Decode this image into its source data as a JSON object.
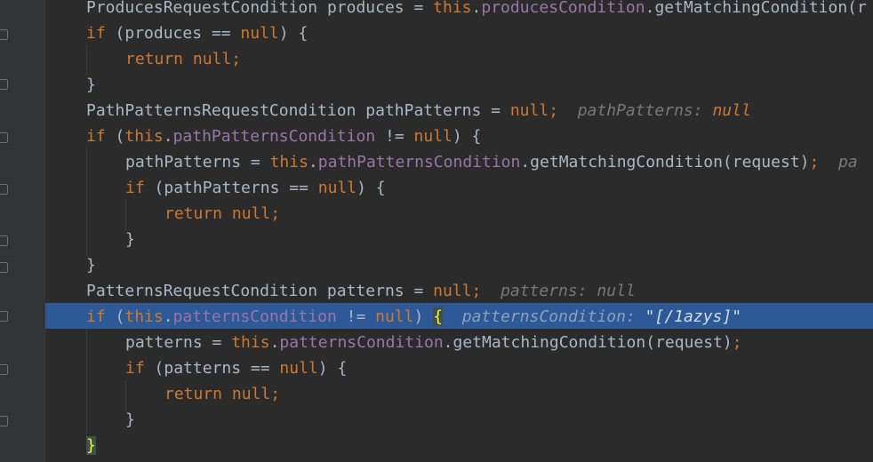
{
  "theme": {
    "background": "#2b2b2b",
    "gutter": "#313335",
    "execution_line": "#2d5a96",
    "keyword": "#cc7832",
    "field": "#9876aa",
    "text": "#a9b7c6"
  },
  "code": {
    "l1": {
      "type": "ProducesRequestCondition",
      "var": "produces",
      "eq": "=",
      "this": "this",
      "dot": ".",
      "field": "producesCondition",
      "call": ".getMatchingCondition(r"
    },
    "l2": {
      "kw": "if",
      "rest": " (produces == ",
      "null": "null",
      "close": ") {"
    },
    "l3": {
      "kw": "return",
      "null": "null",
      "semi": ";"
    },
    "l4": {
      "text": "}"
    },
    "l5": {
      "decl": "PathPatternsRequestCondition pathPatterns = ",
      "null": "null",
      "semi": ";",
      "hint_name": "pathPatterns:",
      "hint_value": "null"
    },
    "l6": {
      "kw": "if",
      "open": " (",
      "this": "this",
      "dot": ".",
      "field": "pathPatternsCondition",
      "op": " != ",
      "null": "null",
      "close": ") {"
    },
    "l7": {
      "lhs": "pathPatterns = ",
      "this": "this",
      "dot": ".",
      "field": "pathPatternsCondition",
      "call": ".getMatchingCondition(request)",
      "semi": ";",
      "hint_name": "pa"
    },
    "l8": {
      "kw": "if",
      "rest": " (pathPatterns == ",
      "null": "null",
      "close": ") {"
    },
    "l9": {
      "kw": "return",
      "null": "null",
      "semi": ";"
    },
    "l10": {
      "text": "}"
    },
    "l11": {
      "text": "}"
    },
    "l12": {
      "decl": "PatternsRequestCondition patterns = ",
      "null": "null",
      "semi": ";",
      "hint_name": "patterns:",
      "hint_value": "null"
    },
    "l13": {
      "kw": "if",
      "open": " (",
      "this": "this",
      "dot": ".",
      "field": "patternsCondition",
      "op": " != ",
      "null": "null",
      "close": ") ",
      "brace": "{",
      "hint_name": "patternsCondition:",
      "hint_value": "\"[/1azys]\""
    },
    "l14": {
      "lhs": "patterns = ",
      "this": "this",
      "dot": ".",
      "field": "patternsCondition",
      "call": ".getMatchingCondition(request)",
      "semi": ";"
    },
    "l15": {
      "kw": "if",
      "rest": " (patterns == ",
      "null": "null",
      "close": ") {"
    },
    "l16": {
      "kw": "return",
      "null": "null",
      "semi": ";"
    },
    "l17": {
      "text": "}"
    },
    "l18": {
      "brace": "}"
    }
  }
}
